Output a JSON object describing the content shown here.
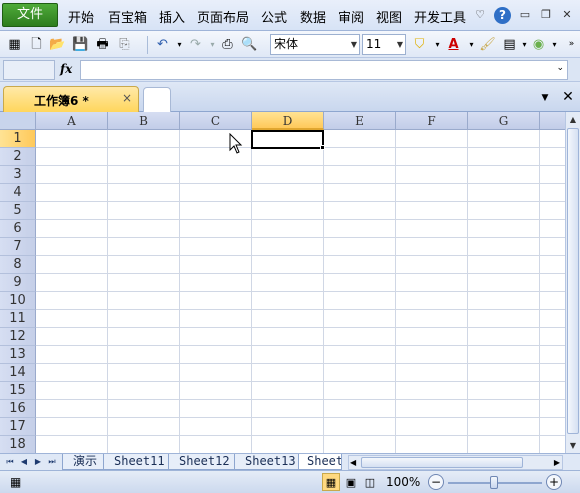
{
  "menubar": {
    "file_label": "文件",
    "items": [
      "开始",
      "百宝箱",
      "插入",
      "页面布局",
      "公式",
      "数据",
      "审阅",
      "视图",
      "开发工具"
    ],
    "help_label": "?"
  },
  "toolbar": {
    "font_name": "宋体",
    "font_size": "11"
  },
  "formula_bar": {
    "fx_label": "fx"
  },
  "doc_tabs": {
    "active_tab": "工作簿6 *",
    "close_glyph": "×"
  },
  "grid": {
    "columns": [
      "A",
      "B",
      "C",
      "D",
      "E",
      "F",
      "G"
    ],
    "rows": [
      "1",
      "2",
      "3",
      "4",
      "5",
      "6",
      "7",
      "8",
      "9",
      "10",
      "11",
      "12",
      "13",
      "14",
      "15",
      "16",
      "17",
      "18"
    ],
    "selected_cell": "D1"
  },
  "sheet_tabs": [
    "演示",
    "Sheet11",
    "Sheet12",
    "Sheet13",
    "Sheet"
  ],
  "active_sheet": "Sheet",
  "status_bar": {
    "zoom": "100%"
  },
  "colors": {
    "file_button": "#3a9430",
    "selected_header": "#ffd065",
    "header_bg": "#c8d4ec"
  }
}
